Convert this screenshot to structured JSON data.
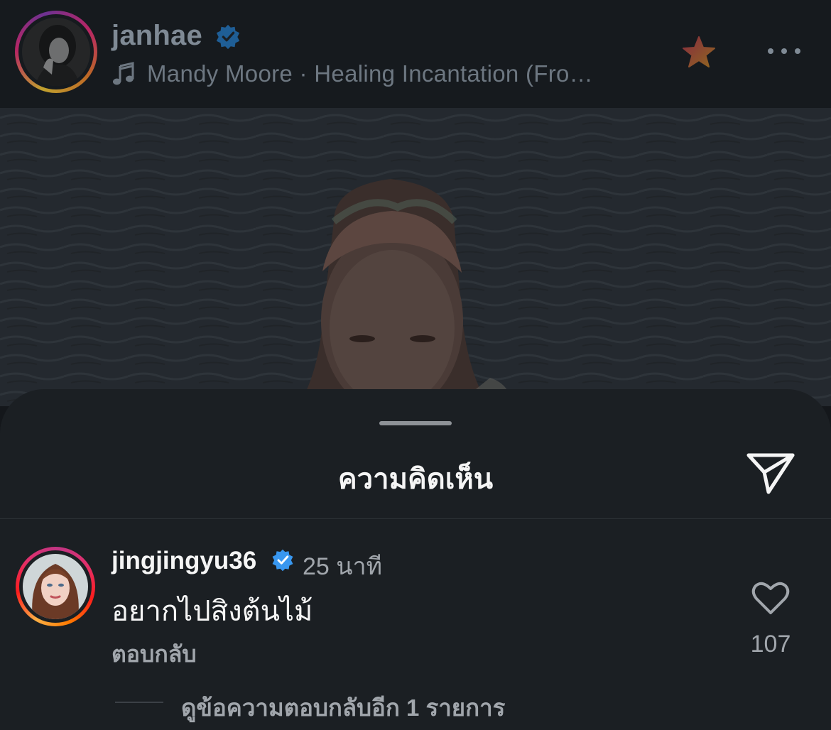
{
  "header": {
    "username": "janhae",
    "verified": true,
    "music": {
      "icon": "music-note-icon",
      "text": "Mandy Moore · Healing Incantation (Fro…"
    },
    "favorite_icon": "star-icon",
    "favorite_colors": [
      "#e23a5a",
      "#f5a623"
    ],
    "more_icon": "more-horizontal-icon"
  },
  "sheet": {
    "title": "ความคิดเห็น",
    "share_icon": "send-icon",
    "comments": [
      {
        "username": "jingjingyu36",
        "verified": true,
        "time": "25 นาที",
        "text": "อยากไปสิงต้นไม้",
        "reply_label": "ตอบกลับ",
        "likes": "107",
        "like_icon": "heart-outline-icon",
        "view_replies_label": "ดูข้อความตอบกลับอีก 1 รายการ"
      }
    ]
  },
  "colors": {
    "background": "#14171b",
    "sheet": "#1b1f23",
    "verified_badge": "#3897f0",
    "secondary_text": "#a1a6ac"
  }
}
